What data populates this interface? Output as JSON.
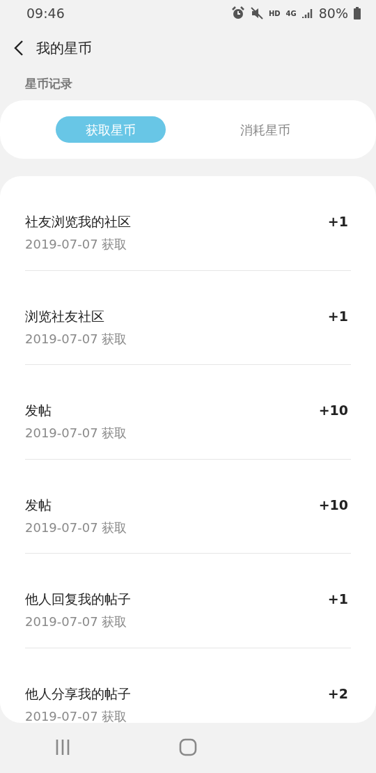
{
  "status_bar": {
    "time": "09:46",
    "hd": "HD",
    "network": "4G",
    "battery": "80%"
  },
  "header": {
    "title": "我的星币"
  },
  "section_label": "星币记录",
  "tabs": [
    {
      "label": "获取星币",
      "selected": true
    },
    {
      "label": "消耗星币",
      "selected": false
    }
  ],
  "records": [
    {
      "title": "社友浏览我的社区",
      "date": "2019-07-07 获取",
      "amount": "+1"
    },
    {
      "title": "浏览社友社区",
      "date": "2019-07-07 获取",
      "amount": "+1"
    },
    {
      "title": "发帖",
      "date": "2019-07-07 获取",
      "amount": "+10"
    },
    {
      "title": "发帖",
      "date": "2019-07-07 获取",
      "amount": "+10"
    },
    {
      "title": "他人回复我的帖子",
      "date": "2019-07-07 获取",
      "amount": "+1"
    },
    {
      "title": "他人分享我的帖子",
      "date": "2019-07-07 获取",
      "amount": "+2"
    }
  ]
}
